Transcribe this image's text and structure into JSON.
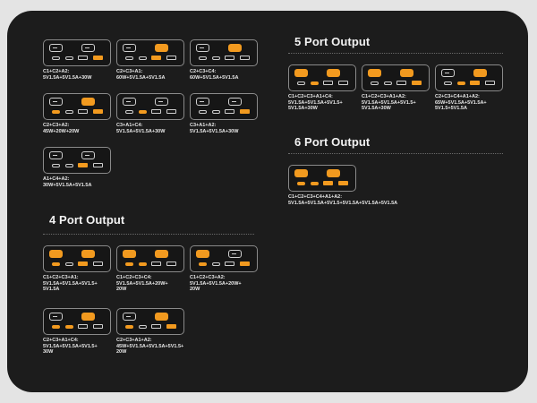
{
  "sections": {
    "five": "5 Port Output",
    "six": "6 Port Output",
    "four": "4 Port Output"
  },
  "colors": {
    "accent": "#f29a1f",
    "panel": "#1c1c1c",
    "outline": "#8a8a8a"
  },
  "port_names": [
    "C1",
    "C2",
    "C3",
    "C4",
    "A1",
    "A2"
  ],
  "three_port": [
    {
      "lines": [
        "C1+C2+A2:",
        "5V1.5A+5V1.5A+30W"
      ],
      "on": [
        "A2"
      ]
    },
    {
      "lines": [
        "C2+C3+A1:",
        "60W+5V1.5A+5V1.5A"
      ],
      "on": [
        "C2",
        "A1"
      ]
    },
    {
      "lines": [
        "C2+C3+C4:",
        "60W+5V1.5A+5V1.5A"
      ],
      "on": [
        "C2"
      ]
    },
    {
      "lines": [
        "C2+C3+A2:",
        "45W+20W+20W"
      ],
      "on": [
        "C2",
        "C3",
        "A2"
      ]
    },
    {
      "lines": [
        "C3+A1+C4:",
        "5V1.5A+5V1.5A+30W"
      ],
      "on": [
        "C4"
      ]
    },
    {
      "lines": [
        "C3+A1+A2:",
        "5V1.5A+5V1.5A+30W"
      ],
      "on": [
        "A2"
      ]
    },
    {
      "lines": [
        "A1+C4+A2:",
        "30W+5V1.5A+5V1.5A"
      ],
      "on": [
        "A1"
      ]
    }
  ],
  "five_port": [
    {
      "lines": [
        "C1+C2+C3+A1+C4:",
        "5V1.5A+5V1.5A+5V1.5+",
        "5V1.5A+30W"
      ],
      "on": [
        "C1",
        "C2",
        "C4"
      ]
    },
    {
      "lines": [
        "C1+C2+C3+A1+A2:",
        "5V1.5A+5V1.5A+5V1.5+",
        "5V1.5A+30W"
      ],
      "on": [
        "C1",
        "C2",
        "A2"
      ]
    },
    {
      "lines": [
        "C2+C3+C4+A1+A2:",
        "65W+5V1.5A+5V1.5A+",
        "5V1.5+5V1.5A"
      ],
      "on": [
        "C2",
        "C4",
        "A1"
      ]
    }
  ],
  "six_port": [
    {
      "lines": [
        "C1+C2+C3+C4+A1+A2:",
        "5V1.5A+5V1.5A+5V1.5+5V1.5A+5V1.5A+5V1.5A"
      ],
      "on": [
        "C1",
        "C2",
        "C3",
        "C4",
        "A1",
        "A2"
      ]
    }
  ],
  "four_port": [
    {
      "lines": [
        "C1+C2+C3+A1:",
        "5V1.5A+5V1.5A+5V1.5+",
        "5V1.5A"
      ],
      "on": [
        "C1",
        "C2",
        "C3",
        "A1"
      ]
    },
    {
      "lines": [
        "C1+C2+C3+C4:",
        "5V1.5A+5V1.5A+20W+",
        "20W"
      ],
      "on": [
        "C1",
        "C2",
        "C3",
        "C4"
      ]
    },
    {
      "lines": [
        "C1+C2+C3+A2:",
        "5V1.5A+5V1.5A+20W+",
        "20W"
      ],
      "on": [
        "C1",
        "C3",
        "A2"
      ]
    },
    {
      "lines": [
        "C2+C3+A1+C4:",
        "5V1.5A+5V1.5A+5V1.5+",
        "30W"
      ],
      "on": [
        "C2",
        "C3",
        "C4"
      ]
    },
    {
      "lines": [
        "C2+C3+A1+A2:",
        "45W+5V1.5A+5V1.5A+5V1.5+",
        "20W"
      ],
      "on": [
        "C2",
        "C3",
        "A2"
      ]
    }
  ]
}
